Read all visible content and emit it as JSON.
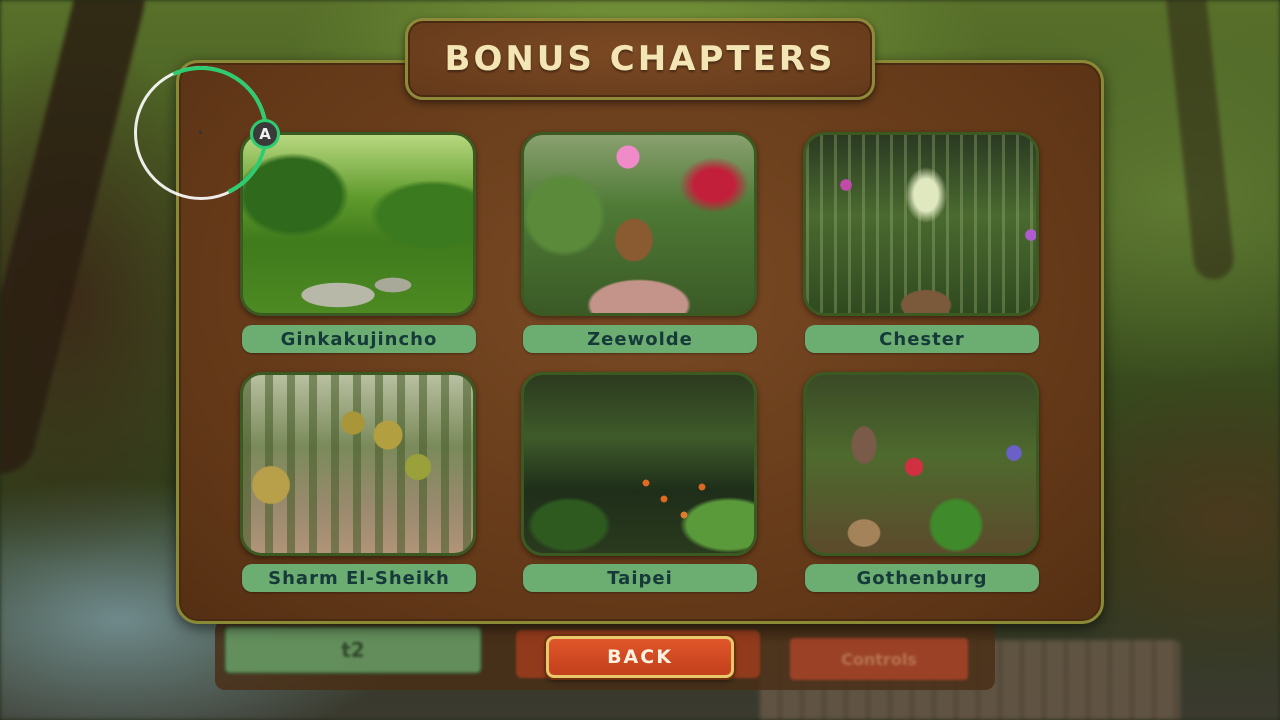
{
  "title": "BONUS CHAPTERS",
  "chapters": [
    {
      "name": "Ginkakujincho"
    },
    {
      "name": "Zeewolde"
    },
    {
      "name": "Chester"
    },
    {
      "name": "Sharm El-Sheikh"
    },
    {
      "name": "Taipei"
    },
    {
      "name": "Gothenburg"
    }
  ],
  "back_label": "BACK",
  "cursor": {
    "button_glyph": "A"
  },
  "background_menu": {
    "left_label": "t2",
    "right_label": "Controls"
  },
  "colors": {
    "panel": "#623818",
    "panel_border": "#8a8a36",
    "title_text": "#f4e6b4",
    "label_bg": "#6cae72",
    "label_text": "#163a3a",
    "back_button": "#c2401c",
    "cursor_accent": "#2ecc71"
  }
}
